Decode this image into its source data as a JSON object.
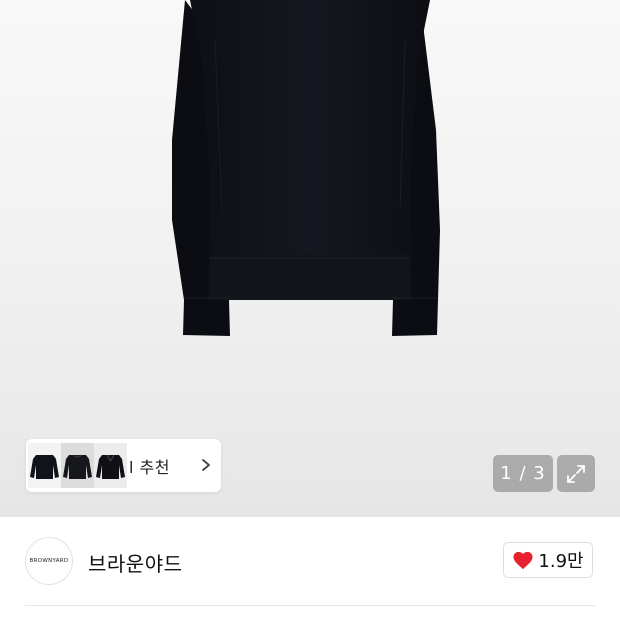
{
  "gallery": {
    "current_page": 1,
    "total_pages": 3,
    "counter_text": "1 / 3",
    "expand_icon": "expand-arrows-icon"
  },
  "recommendation": {
    "label": "l 추천",
    "chevron_icon": "chevron-right-icon",
    "thumbnails": [
      "black-sweater-thumbnail",
      "black-sweater-thumbnail",
      "black-sweater-thumbnail"
    ]
  },
  "brand": {
    "logo_text": "BROWNYARD",
    "name": "브라운야드"
  },
  "like": {
    "icon": "heart-icon",
    "color": "#e8212e",
    "count": "1.9만"
  }
}
